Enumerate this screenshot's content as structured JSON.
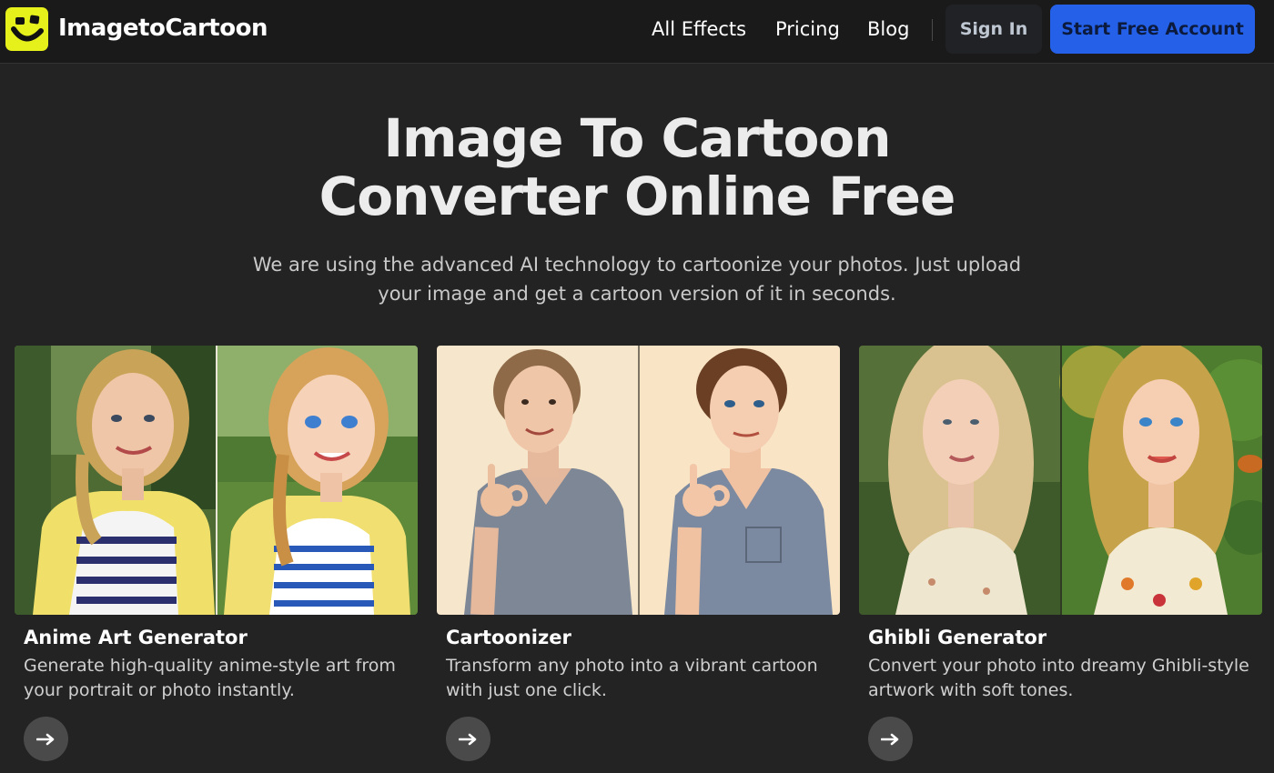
{
  "header": {
    "brand": "ImagetoCartoon",
    "nav": [
      "All Effects",
      "Pricing",
      "Blog"
    ],
    "sign_in": "Sign In",
    "start": "Start Free Account"
  },
  "hero": {
    "title_line1": "Image To Cartoon",
    "title_line2": "Converter Online Free",
    "subtitle_line1": "We are using the advanced AI technology to cartoonize your photos. Just upload",
    "subtitle_line2": "your image and get a cartoon version of it in seconds."
  },
  "cards": [
    {
      "title": "Anime Art Generator",
      "desc": "Generate high-quality anime-style art from your portrait or photo instantly."
    },
    {
      "title": "Cartoonizer",
      "desc": "Transform any photo into a vibrant cartoon with just one click."
    },
    {
      "title": "Ghibli Generator",
      "desc": "Convert your photo into dreamy Ghibli-style artwork with soft tones."
    }
  ],
  "colors": {
    "background": "#232323",
    "header": "#1a1a1a",
    "logo": "#e6f01a",
    "primary_button": "#2561e8"
  },
  "icons": {
    "logo": "smiley-logo-icon",
    "card_arrow": "arrow-right-icon"
  }
}
